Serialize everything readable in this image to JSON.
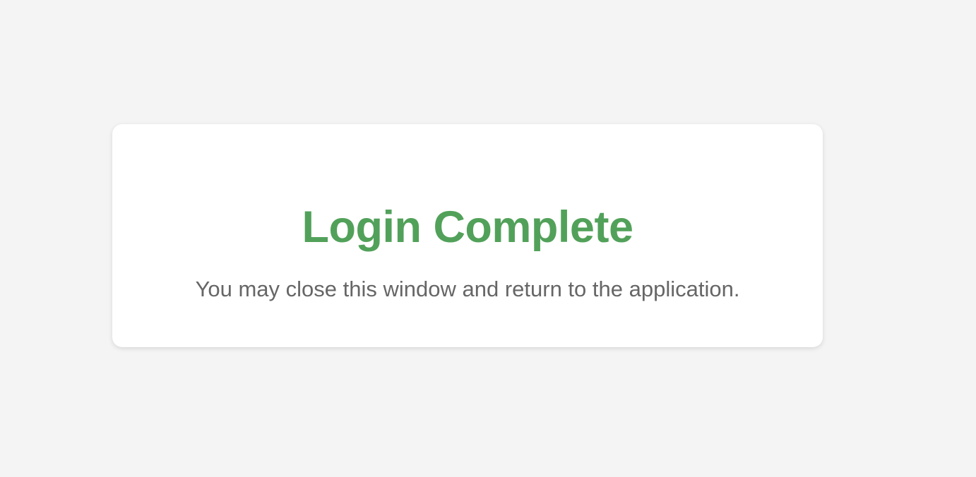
{
  "page": {
    "background_color": "#f4f4f4"
  },
  "card": {
    "title": "Login Complete",
    "title_color": "#52a15a",
    "message": "You may close this window and return to the application."
  }
}
